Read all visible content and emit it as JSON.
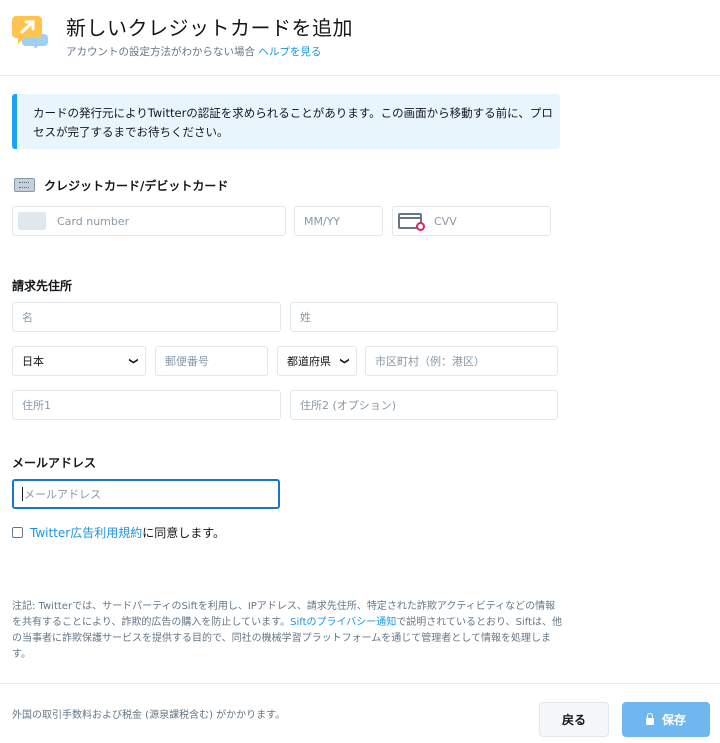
{
  "header": {
    "icon": "help-chat-icon",
    "title": "新しいクレジットカードを追加",
    "subtitle": "アカウントの設定方法がわからない場合",
    "help_link": "ヘルプを見る"
  },
  "notice": {
    "text": "カードの発行元によりTwitterの認証を求められることがあります。この画面から移動する前に、プロセスが完了するまでお待ちください。"
  },
  "card_section": {
    "icon": "credit-card-icon",
    "title": "クレジットカード/デビットカード",
    "card_number_placeholder": "Card number",
    "expiry_placeholder": "MM/YY",
    "cvv_placeholder": "CVV"
  },
  "billing_section": {
    "title": "請求先住所",
    "first_name_placeholder": "名",
    "last_name_placeholder": "姓",
    "country_value": "日本",
    "postal_code_placeholder": "郵便番号",
    "prefecture_value": "都道府県",
    "city_placeholder": "市区町村（例：港区）",
    "address1_placeholder": "住所1",
    "address2_placeholder": "住所2 (オプション)"
  },
  "email_section": {
    "title": "メールアドレス",
    "email_placeholder": "メールアドレス"
  },
  "terms": {
    "checked": false,
    "link_text": "Twitter広告利用規約",
    "suffix": "に同意します。"
  },
  "legal": {
    "part1": "注記: Twitterでは、サードパーティのSiftを利用し、IPアドレス、請求先住所、特定された詐欺アクティビティなどの情報を共有することにより、詐欺的広告の購入を防止しています。",
    "link": "Siftのプライバシー通知",
    "part2": "で説明されているとおり、Siftは、他の当事者に詐欺保護サービスを提供する目的で、同社の機械学習プラットフォームを通じて管理者として情報を処理します。"
  },
  "footer": {
    "note": "外国の取引手数料および税金 (源泉課税含む) がかかります。",
    "back_label": "戻る",
    "save_label": "保存"
  },
  "colors": {
    "accent": "#1da1f2",
    "link": "#1b95e0",
    "notice_bg": "#e8f5fd",
    "save_button": "#6eb8ef",
    "focus_border": "#1b75d0"
  }
}
